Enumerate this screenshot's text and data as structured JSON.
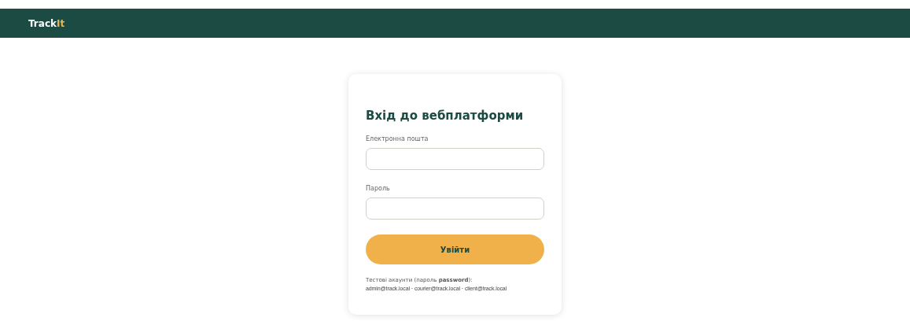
{
  "header": {
    "logo": "Track",
    "logo_accent": "It"
  },
  "login": {
    "title": "Вхід до вебплатформи",
    "fields": [
      {
        "label": "Електронна пошта"
      },
      {
        "label": "Пароль"
      }
    ],
    "submit": "Увійти",
    "hint": "Тестові акаунти (пароль **password**):",
    "accounts": "admin@track.local · courier@track.local · client@track.local"
  }
}
